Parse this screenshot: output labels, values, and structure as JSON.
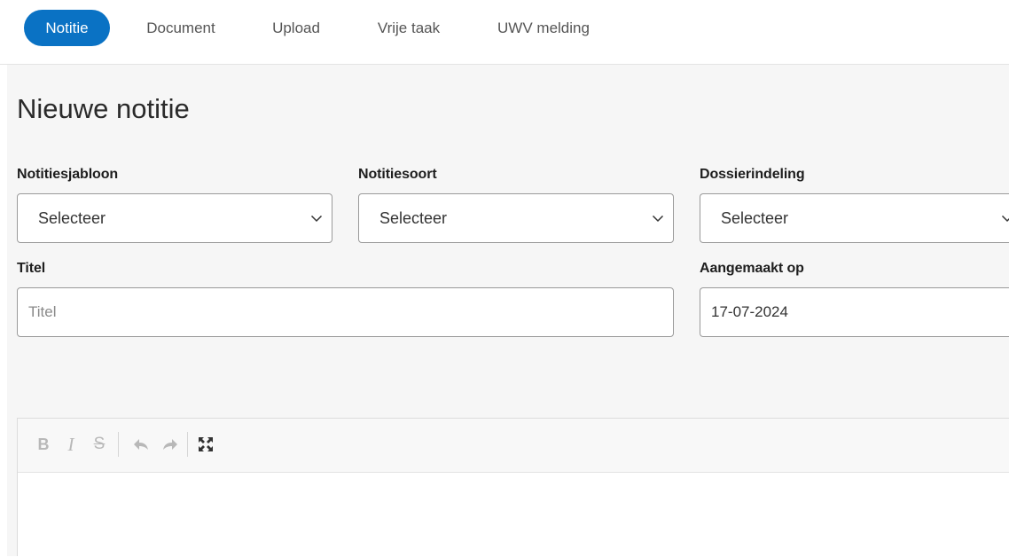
{
  "tabs": [
    {
      "label": "Notitie",
      "active": true
    },
    {
      "label": "Document",
      "active": false
    },
    {
      "label": "Upload",
      "active": false
    },
    {
      "label": "Vrije taak",
      "active": false
    },
    {
      "label": "UWV melding",
      "active": false
    }
  ],
  "page": {
    "title": "Nieuwe notitie"
  },
  "form": {
    "template": {
      "label": "Notitiesjabloon",
      "value": "Selecteer"
    },
    "type": {
      "label": "Notitiesoort",
      "value": "Selecteer"
    },
    "folder": {
      "label": "Dossierindeling",
      "value": "Selecteer"
    },
    "title": {
      "label": "Titel",
      "placeholder": "Titel",
      "value": ""
    },
    "created": {
      "label": "Aangemaakt op",
      "value": "17-07-2024"
    }
  },
  "editor": {
    "toolbar": [
      "bold-icon",
      "italic-icon",
      "strikethrough-icon",
      "undo-icon",
      "redo-icon",
      "fullscreen-icon"
    ],
    "content": ""
  },
  "colors": {
    "accent": "#0a72c4",
    "background": "#f6f6f6",
    "border": "#9a9a9a"
  }
}
